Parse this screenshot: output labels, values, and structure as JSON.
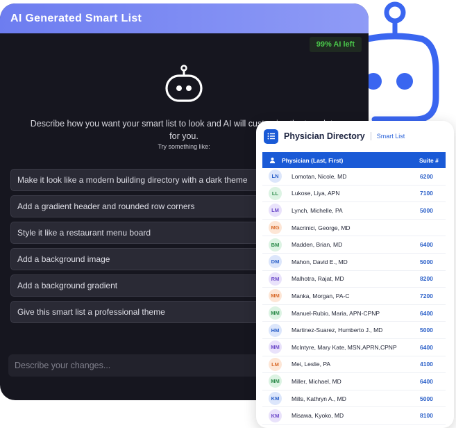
{
  "ai_panel": {
    "title": "AI Generated Smart List",
    "quota": "99% AI left",
    "description": "Describe how you want your smart list to look and AI will customize the template for you.",
    "hint": "Try something like:",
    "suggestions": [
      "Make it look like a modern building directory with a dark theme",
      "Add a gradient header and rounded row corners",
      "Style it like a restaurant menu board",
      "Add a background image",
      "Add a background gradient",
      "Give this smart list a professional theme"
    ],
    "input_placeholder": "Describe your changes..."
  },
  "directory": {
    "title": "Physician Directory",
    "subtitle": "Smart List",
    "columns": [
      "Physician (Last, First)",
      "Suite #"
    ],
    "rows": [
      {
        "initials": "LN",
        "color": "blue",
        "name": "Lomotan, Nicole, MD",
        "suite": "6200"
      },
      {
        "initials": "LL",
        "color": "green",
        "name": "Lukose, Liya, APN",
        "suite": "7100"
      },
      {
        "initials": "LM",
        "color": "purple",
        "name": "Lynch, Michelle, PA",
        "suite": "5000"
      },
      {
        "initials": "MG",
        "color": "orange",
        "name": "Macrinici, George, MD",
        "suite": ""
      },
      {
        "initials": "BM",
        "color": "green",
        "name": "Madden, Brian, MD",
        "suite": "6400"
      },
      {
        "initials": "DM",
        "color": "blue",
        "name": "Mahon, David E., MD",
        "suite": "5000"
      },
      {
        "initials": "RM",
        "color": "purple",
        "name": "Malhotra, Rajat, MD",
        "suite": "8200"
      },
      {
        "initials": "MM",
        "color": "orange",
        "name": "Manka, Morgan, PA-C",
        "suite": "7200"
      },
      {
        "initials": "MM",
        "color": "green",
        "name": "Manuel-Rubio, Maria, APN-CPNP",
        "suite": "6400"
      },
      {
        "initials": "HM",
        "color": "blue",
        "name": "Martinez-Suarez, Humberto J., MD",
        "suite": "5000"
      },
      {
        "initials": "MM",
        "color": "purple",
        "name": "McIntyre, Mary Kate, MSN,APRN,CPNP",
        "suite": "6400"
      },
      {
        "initials": "LM",
        "color": "orange",
        "name": "Mei, Leslie, PA",
        "suite": "4100"
      },
      {
        "initials": "MM",
        "color": "green",
        "name": "Miller, Michael, MD",
        "suite": "6400"
      },
      {
        "initials": "KM",
        "color": "blue",
        "name": "Mills, Kathryn A., MD",
        "suite": "5000"
      },
      {
        "initials": "KM",
        "color": "purple",
        "name": "Misawa, Kyoko, MD",
        "suite": "8100"
      }
    ]
  },
  "colors": {
    "accent": "#1a5ad6",
    "robot": "#3a66f0",
    "header_gradient_start": "#6d7df0",
    "header_gradient_end": "#8f9bf6",
    "quota_text": "#4ac84a"
  }
}
